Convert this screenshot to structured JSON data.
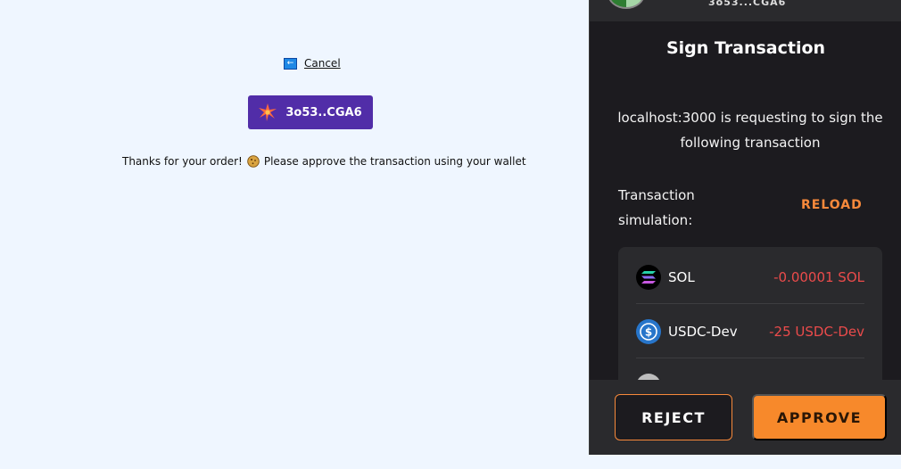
{
  "checkout": {
    "cancel_label": "Cancel",
    "wallet_button_label": "3o53..CGA6",
    "thanks_before": "Thanks for your order!",
    "thanks_after": "Please approve the transaction using your wallet"
  },
  "wallet": {
    "account_name": "3o53...CGA6",
    "title": "Sign Transaction",
    "request_text": "localhost:3000 is requesting to sign the following transaction",
    "simulation_label": "Transaction simulation:",
    "reload_label": "RELOAD",
    "simulation_rows": [
      {
        "token": "SOL",
        "delta": "-0.00001 SOL",
        "icon": "solana-icon"
      },
      {
        "token": "USDC-Dev",
        "delta": "-25 USDC-Dev",
        "icon": "usdc-icon"
      }
    ],
    "reject_label": "REJECT",
    "approve_label": "APPROVE"
  },
  "colors": {
    "page_bg": "#eff6ff",
    "wallet_button": "#512da8",
    "wallet_bg": "#1c1b1f",
    "accent_orange": "#f7893b",
    "negative_red": "#eb4b4b"
  }
}
